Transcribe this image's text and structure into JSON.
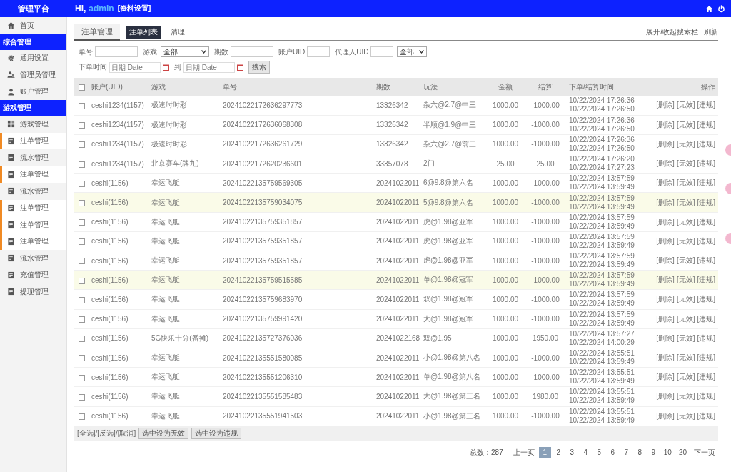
{
  "topbar": {
    "brand": "管理平台",
    "greeting": "Hi,",
    "user": "admin",
    "profile_link": "[资料设置]"
  },
  "sidebar": {
    "home": "首页",
    "sections": [
      {
        "title": "综合管理",
        "items": [
          {
            "label": "通用设置",
            "marked": false
          },
          {
            "label": "管理员管理",
            "marked": false
          },
          {
            "label": "账户管理",
            "marked": false
          }
        ]
      },
      {
        "title": "游戏管理",
        "items": [
          {
            "label": "游戏管理",
            "marked": false
          },
          {
            "label": "注单管理",
            "marked": true
          },
          {
            "label": "流水管理",
            "marked": false
          },
          {
            "label": "注单管理",
            "marked": true
          },
          {
            "label": "流水管理",
            "marked": false
          },
          {
            "label": "注单管理",
            "marked": true
          },
          {
            "label": "注单管理",
            "marked": true
          },
          {
            "label": "注单管理",
            "marked": true
          },
          {
            "label": "流水管理",
            "marked": false
          },
          {
            "label": "充值管理",
            "marked": false
          },
          {
            "label": "提现管理",
            "marked": false
          }
        ]
      }
    ]
  },
  "page_title": "注单管理",
  "tabs": [
    {
      "label": "注单列表",
      "selected": true
    },
    {
      "label": "清理",
      "selected": false
    }
  ],
  "top_links": [
    "展开/收起搜索栏",
    "刷新"
  ],
  "filters": {
    "bet_no_label": "单号",
    "game_label": "游戏",
    "game_value": "全部",
    "period_label": "期数",
    "account_label": "账户UID",
    "agent_label": "代理人UID",
    "type_value": "全部",
    "time_label": "下单时间",
    "date_from_placeholder": "日期 Date",
    "to_label": "到",
    "date_to_placeholder": "日期 Date",
    "search_button": "搜索"
  },
  "table": {
    "select_all_checked": false,
    "columns": [
      "账户(UID)",
      "游戏",
      "单号",
      "期数",
      "玩法",
      "金额",
      "结算",
      "下单/结算时间",
      "操作"
    ],
    "rows": [
      {
        "checked": false,
        "highlighted": false,
        "account": "ceshi1234(1157)",
        "game": "极速时时彩",
        "bet_no": "20241022172636297773",
        "period": "13326342",
        "play": "杂六@2.7@中三",
        "amount": "1000.00",
        "result": "-1000.00",
        "times": [
          "10/22/2024 17:26:36",
          "10/22/2024 17:26:50"
        ],
        "actions": [
          "[删除]",
          "[无效]",
          "[违规]"
        ]
      },
      {
        "checked": false,
        "highlighted": false,
        "account": "ceshi1234(1157)",
        "game": "极速时时彩",
        "bet_no": "20241022172636068308",
        "period": "13326342",
        "play": "半顺@1.9@中三",
        "amount": "1000.00",
        "result": "-1000.00",
        "times": [
          "10/22/2024 17:26:36",
          "10/22/2024 17:26:50"
        ],
        "actions": [
          "[删除]",
          "[无效]",
          "[违规]"
        ]
      },
      {
        "checked": false,
        "highlighted": false,
        "account": "ceshi1234(1157)",
        "game": "极速时时彩",
        "bet_no": "20241022172636261729",
        "period": "13326342",
        "play": "杂六@2.7@前三",
        "amount": "1000.00",
        "result": "-1000.00",
        "times": [
          "10/22/2024 17:26:36",
          "10/22/2024 17:26:50"
        ],
        "actions": [
          "[删除]",
          "[无效]",
          "[违规]"
        ]
      },
      {
        "checked": false,
        "highlighted": false,
        "account": "ceshi1234(1157)",
        "game": "北京赛车(牌九)",
        "bet_no": "20241022172620236601",
        "period": "33357078",
        "play": "2门",
        "amount": "25.00",
        "result": "25.00",
        "times": [
          "10/22/2024 17:26:20",
          "10/22/2024 17:27:23"
        ],
        "actions": [
          "[删除]",
          "[无效]",
          "[违规]"
        ]
      },
      {
        "checked": false,
        "highlighted": false,
        "account": "ceshi(1156)",
        "game": "幸运飞艇",
        "bet_no": "20241022135759569305",
        "period": "20241022011",
        "play": "6@9.8@第六名",
        "amount": "1000.00",
        "result": "-1000.00",
        "times": [
          "10/22/2024 13:57:59",
          "10/22/2024 13:59:49"
        ],
        "actions": [
          "[删除]",
          "[无效]",
          "[违规]"
        ]
      },
      {
        "checked": false,
        "highlighted": true,
        "account": "ceshi(1156)",
        "game": "幸运飞艇",
        "bet_no": "20241022135759034075",
        "period": "20241022011",
        "play": "5@9.8@第六名",
        "amount": "1000.00",
        "result": "-1000.00",
        "times": [
          "10/22/2024 13:57:59",
          "10/22/2024 13:59:49"
        ],
        "actions": [
          "[删除]",
          "[无效]",
          "[违规]"
        ]
      },
      {
        "checked": false,
        "highlighted": false,
        "account": "ceshi(1156)",
        "game": "幸运飞艇",
        "bet_no": "20241022135759351857",
        "period": "20241022011",
        "play": "虎@1.98@亚军",
        "amount": "1000.00",
        "result": "-1000.00",
        "times": [
          "10/22/2024 13:57:59",
          "10/22/2024 13:59:49"
        ],
        "actions": [
          "[删除]",
          "[无效]",
          "[违规]"
        ]
      },
      {
        "checked": false,
        "highlighted": false,
        "account": "ceshi(1156)",
        "game": "幸运飞艇",
        "bet_no": "20241022135759351857",
        "period": "20241022011",
        "play": "虎@1.98@亚军",
        "amount": "1000.00",
        "result": "-1000.00",
        "times": [
          "10/22/2024 13:57:59",
          "10/22/2024 13:59:49"
        ],
        "actions": [
          "[删除]",
          "[无效]",
          "[违规]"
        ]
      },
      {
        "checked": false,
        "highlighted": false,
        "account": "ceshi(1156)",
        "game": "幸运飞艇",
        "bet_no": "20241022135759351857",
        "period": "20241022011",
        "play": "虎@1.98@亚军",
        "amount": "1000.00",
        "result": "-1000.00",
        "times": [
          "10/22/2024 13:57:59",
          "10/22/2024 13:59:49"
        ],
        "actions": [
          "[删除]",
          "[无效]",
          "[违规]"
        ]
      },
      {
        "checked": false,
        "highlighted": true,
        "account": "ceshi(1156)",
        "game": "幸运飞艇",
        "bet_no": "20241022135759515585",
        "period": "20241022011",
        "play": "单@1.98@冠军",
        "amount": "1000.00",
        "result": "-1000.00",
        "times": [
          "10/22/2024 13:57:59",
          "10/22/2024 13:59:49"
        ],
        "actions": [
          "[删除]",
          "[无效]",
          "[违规]"
        ]
      },
      {
        "checked": false,
        "highlighted": false,
        "account": "ceshi(1156)",
        "game": "幸运飞艇",
        "bet_no": "20241022135759683970",
        "period": "20241022011",
        "play": "双@1.98@冠军",
        "amount": "1000.00",
        "result": "-1000.00",
        "times": [
          "10/22/2024 13:57:59",
          "10/22/2024 13:59:49"
        ],
        "actions": [
          "[删除]",
          "[无效]",
          "[违规]"
        ]
      },
      {
        "checked": false,
        "highlighted": false,
        "account": "ceshi(1156)",
        "game": "幸运飞艇",
        "bet_no": "20241022135759991420",
        "period": "20241022011",
        "play": "大@1.98@冠军",
        "amount": "1000.00",
        "result": "-1000.00",
        "times": [
          "10/22/2024 13:57:59",
          "10/22/2024 13:59:49"
        ],
        "actions": [
          "[删除]",
          "[无效]",
          "[违规]"
        ]
      },
      {
        "checked": false,
        "highlighted": false,
        "account": "ceshi(1156)",
        "game": "5G快乐十分(番摊)",
        "bet_no": "20241022135727376036",
        "period": "20241022168",
        "play": "双@1.95",
        "amount": "1000.00",
        "result": "1950.00",
        "times": [
          "10/22/2024 13:57:27",
          "10/22/2024 14:00:29"
        ],
        "actions": [
          "[删除]",
          "[无效]",
          "[违规]"
        ]
      },
      {
        "checked": false,
        "highlighted": false,
        "account": "ceshi(1156)",
        "game": "幸运飞艇",
        "bet_no": "20241022135551580085",
        "period": "20241022011",
        "play": "小@1.98@第八名",
        "amount": "1000.00",
        "result": "-1000.00",
        "times": [
          "10/22/2024 13:55:51",
          "10/22/2024 13:59:49"
        ],
        "actions": [
          "[删除]",
          "[无效]",
          "[违规]"
        ]
      },
      {
        "checked": false,
        "highlighted": false,
        "account": "ceshi(1156)",
        "game": "幸运飞艇",
        "bet_no": "20241022135551206310",
        "period": "20241022011",
        "play": "单@1.98@第八名",
        "amount": "1000.00",
        "result": "-1000.00",
        "times": [
          "10/22/2024 13:55:51",
          "10/22/2024 13:59:49"
        ],
        "actions": [
          "[删除]",
          "[无效]",
          "[违规]"
        ]
      },
      {
        "checked": false,
        "highlighted": false,
        "account": "ceshi(1156)",
        "game": "幸运飞艇",
        "bet_no": "20241022135551585483",
        "period": "20241022011",
        "play": "大@1.98@第三名",
        "amount": "1000.00",
        "result": "1980.00",
        "times": [
          "10/22/2024 13:55:51",
          "10/22/2024 13:59:49"
        ],
        "actions": [
          "[删除]",
          "[无效]",
          "[违规]"
        ]
      },
      {
        "checked": false,
        "highlighted": false,
        "account": "ceshi(1156)",
        "game": "幸运飞艇",
        "bet_no": "20241022135551941503",
        "period": "20241022011",
        "play": "小@1.98@第三名",
        "amount": "1000.00",
        "result": "-1000.00",
        "times": [
          "10/22/2024 13:55:51",
          "10/22/2024 13:59:49"
        ],
        "actions": [
          "[删除]",
          "[无效]",
          "[违规]"
        ]
      }
    ]
  },
  "bulk": {
    "select_links": "[全选]/[反选]/[取消]",
    "buttons": [
      "选中设为无效",
      "选中设为违规"
    ]
  },
  "pagination": {
    "total": "总数：287",
    "prev": "上一页",
    "pages": [
      {
        "label": "1",
        "selected": true
      },
      {
        "label": "2",
        "selected": false
      },
      {
        "label": "3",
        "selected": false
      },
      {
        "label": "4",
        "selected": false
      },
      {
        "label": "5",
        "selected": false
      },
      {
        "label": "6",
        "selected": false
      },
      {
        "label": "7",
        "selected": false
      },
      {
        "label": "8",
        "selected": false
      },
      {
        "label": "9",
        "selected": false
      },
      {
        "label": "10",
        "selected": false
      },
      {
        "label": "20",
        "selected": false
      }
    ],
    "next": "下一页"
  }
}
